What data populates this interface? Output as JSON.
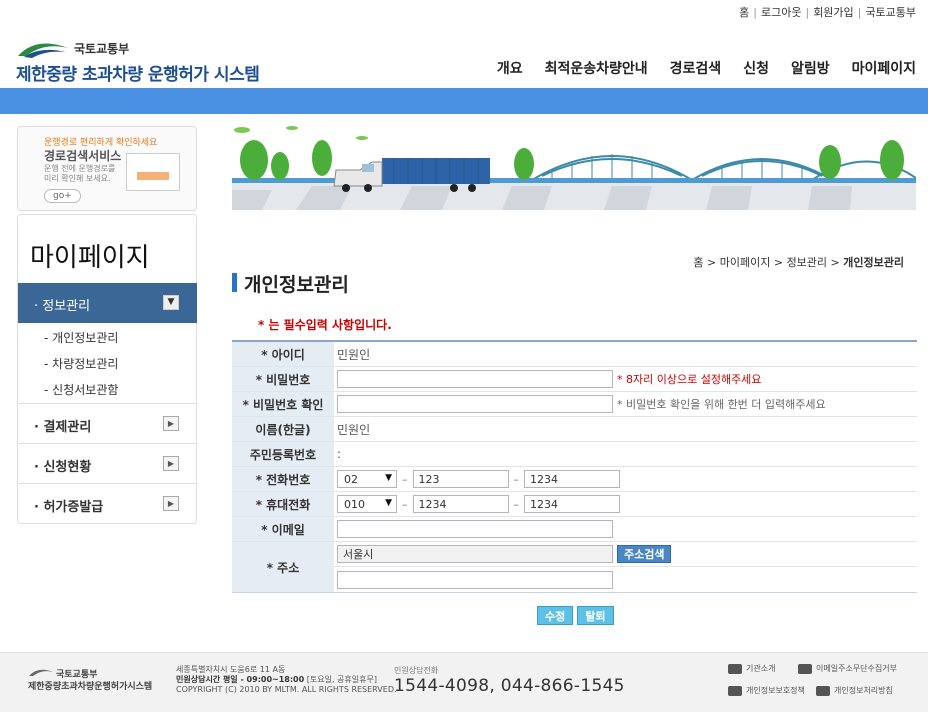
{
  "util_links": [
    "홈",
    "로그아웃",
    "회원가입",
    "국토교통부"
  ],
  "logo": {
    "ministry": "국토교통부",
    "title": "제한중량 초과차량 운행허가 시스템"
  },
  "gnb": [
    "개요",
    "최적운송차량안내",
    "경로검색",
    "신청",
    "알림방",
    "마이페이지"
  ],
  "promo": {
    "tagline": "운행경로 편리하게 확인하세요",
    "title": "경로검색서비스",
    "desc": "운행 전에 운행경로를 미리 확인해 보세요.",
    "go": "go+"
  },
  "leftmenu": {
    "title": "마이페이지",
    "active": "정보관리",
    "subs": [
      "개인정보관리",
      "차량정보관리",
      "신청서보관함"
    ],
    "items": [
      "결제관리",
      "신청현황",
      "허가증발급"
    ]
  },
  "breadcrumb": {
    "home": "홈",
    "p1": "마이페이지",
    "p2": "정보관리",
    "current": "개인정보관리"
  },
  "page_title": "개인정보관리",
  "required_note": "* 는 필수입력 사항입니다.",
  "form": {
    "id_label": "* 아이디",
    "id_value": "민원인",
    "pw_label": "* 비밀번호",
    "pw_hint": "* 8자리 이상으로 설정해주세요",
    "pw2_label": "* 비밀번호 확인",
    "pw2_hint": "* 비밀번호 확인을 위해 한번 더 입력해주세요",
    "name_label": "이름(한글)",
    "name_value": "민원인",
    "rrn_label": "주민등록번호",
    "rrn_value": ":",
    "tel_label": "* 전화번호",
    "tel_area": "02",
    "tel_mid": "123",
    "tel_last": "1234",
    "mobile_label": "* 휴대전화",
    "mobile_pre": "010",
    "mobile_mid": "1234",
    "mobile_last": "1234",
    "email_label": "* 이메일",
    "email_value": "",
    "addr_label": "* 주소",
    "addr1": "서울시",
    "addr2": "",
    "addr_button": "주소검색"
  },
  "buttons": {
    "edit": "수정",
    "withdraw": "탈퇴"
  },
  "footer": {
    "ministry": "국토교통부",
    "system": "제한중량초과차량운행허가시스템",
    "address": "세종특별자치시 도움6로 11 A동",
    "hours_label": "민원상담시간 평일 - 09:00~18:00",
    "hours_note": "[토요일, 공휴일휴무]",
    "copyright": "COPYRIGHT (C) 2010 BY MLTM. ALL RIGHTS RESERVED.",
    "phone_label": "민원상담전화",
    "phone": "1544-4098, 044-866-1545",
    "links": [
      "기관소개",
      "이메일주소무단수집거부",
      "개인정보보호정책",
      "개인정보처리방침"
    ]
  },
  "colors": {
    "accent": "#4a90e2",
    "menu_active": "#3b6796",
    "required": "#cc0000"
  }
}
